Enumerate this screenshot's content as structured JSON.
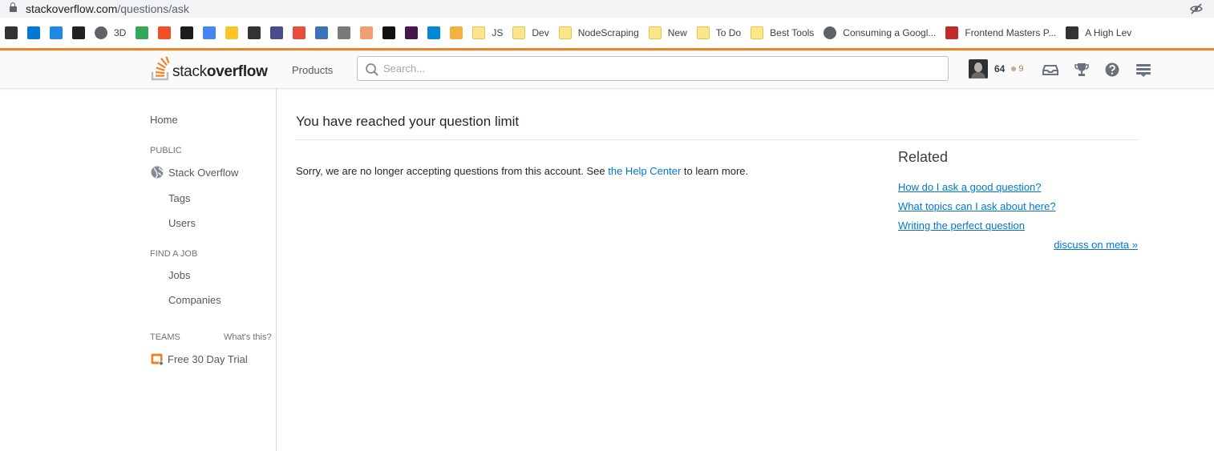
{
  "browser": {
    "url_host": "stackoverflow.com",
    "url_path": "/questions/ask"
  },
  "bookmarks": [
    {
      "icon": "app-icon",
      "label": "",
      "color": "#333333"
    },
    {
      "icon": "azure-devops-icon",
      "label": "",
      "color": "#0078d4"
    },
    {
      "icon": "checkmark-icon",
      "label": "",
      "color": "#1e88e5"
    },
    {
      "icon": "museum-icon",
      "label": "",
      "color": "#222222"
    },
    {
      "icon": "globe-icon",
      "label": "3D",
      "color": "#5f6368"
    },
    {
      "icon": "code-icon",
      "label": "",
      "color": "#34a853"
    },
    {
      "icon": "windows-icon",
      "label": "",
      "color": "#f25022"
    },
    {
      "icon": "angular-icon",
      "label": "",
      "color": "#1c1c1c"
    },
    {
      "icon": "google-icon",
      "label": "",
      "color": "#4285f4"
    },
    {
      "icon": "bulb-icon",
      "label": "",
      "color": "#f9c623"
    },
    {
      "icon": "box-icon",
      "label": "",
      "color": "#333333"
    },
    {
      "icon": "js-icon",
      "label": "",
      "color": "#4a4a8c"
    },
    {
      "icon": "swatch-icon",
      "label": "",
      "color": "#e94b3c"
    },
    {
      "icon": "list-icon",
      "label": "",
      "color": "#3b73b9"
    },
    {
      "icon": "search-box-icon",
      "label": "",
      "color": "#7a7a7a"
    },
    {
      "icon": "hexagon-icon",
      "label": "",
      "color": "#f0a070"
    },
    {
      "icon": "notion-icon",
      "label": "",
      "color": "#111111"
    },
    {
      "icon": "slack-icon",
      "label": "",
      "color": "#4a154b"
    },
    {
      "icon": "azure-icon",
      "label": "",
      "color": "#0089d6"
    },
    {
      "icon": "package-icon",
      "label": "",
      "color": "#f2b33d"
    },
    {
      "icon": "folder-icon",
      "label": "JS",
      "color": ""
    },
    {
      "icon": "folder-icon",
      "label": "Dev",
      "color": ""
    },
    {
      "icon": "folder-icon",
      "label": "NodeScraping",
      "color": ""
    },
    {
      "icon": "folder-icon",
      "label": "New",
      "color": ""
    },
    {
      "icon": "folder-icon",
      "label": "To Do",
      "color": ""
    },
    {
      "icon": "folder-icon",
      "label": "Best Tools",
      "color": ""
    },
    {
      "icon": "globe-icon",
      "label": "Consuming a Googl...",
      "color": "#5f6368"
    },
    {
      "icon": "fm-icon",
      "label": "Frontend Masters P...",
      "color": "#c02d28"
    },
    {
      "icon": "codesandbox-icon",
      "label": "A High Lev",
      "color": "#333333"
    }
  ],
  "header": {
    "logo_light": "stack",
    "logo_bold": "overflow",
    "products_label": "Products",
    "search_placeholder": "Search...",
    "reputation": "64",
    "bronze_count": "9",
    "accent_color": "#f48024"
  },
  "sidebar": {
    "home": "Home",
    "public_heading": "PUBLIC",
    "stack_overflow": "Stack Overflow",
    "tags": "Tags",
    "users": "Users",
    "find_job_heading": "FIND A JOB",
    "jobs": "Jobs",
    "companies": "Companies",
    "teams_heading": "TEAMS",
    "whats_this": "What's this?",
    "free_trial": "Free 30 Day Trial"
  },
  "main": {
    "title": "You have reached your question limit",
    "message_before": "Sorry, we are no longer accepting questions from this account. See ",
    "message_link": "the Help Center",
    "message_after": " to learn more."
  },
  "related": {
    "title": "Related",
    "links": [
      "How do I ask a good question?",
      "What topics can I ask about here?",
      "Writing the perfect question"
    ],
    "meta": "discuss on meta »"
  }
}
